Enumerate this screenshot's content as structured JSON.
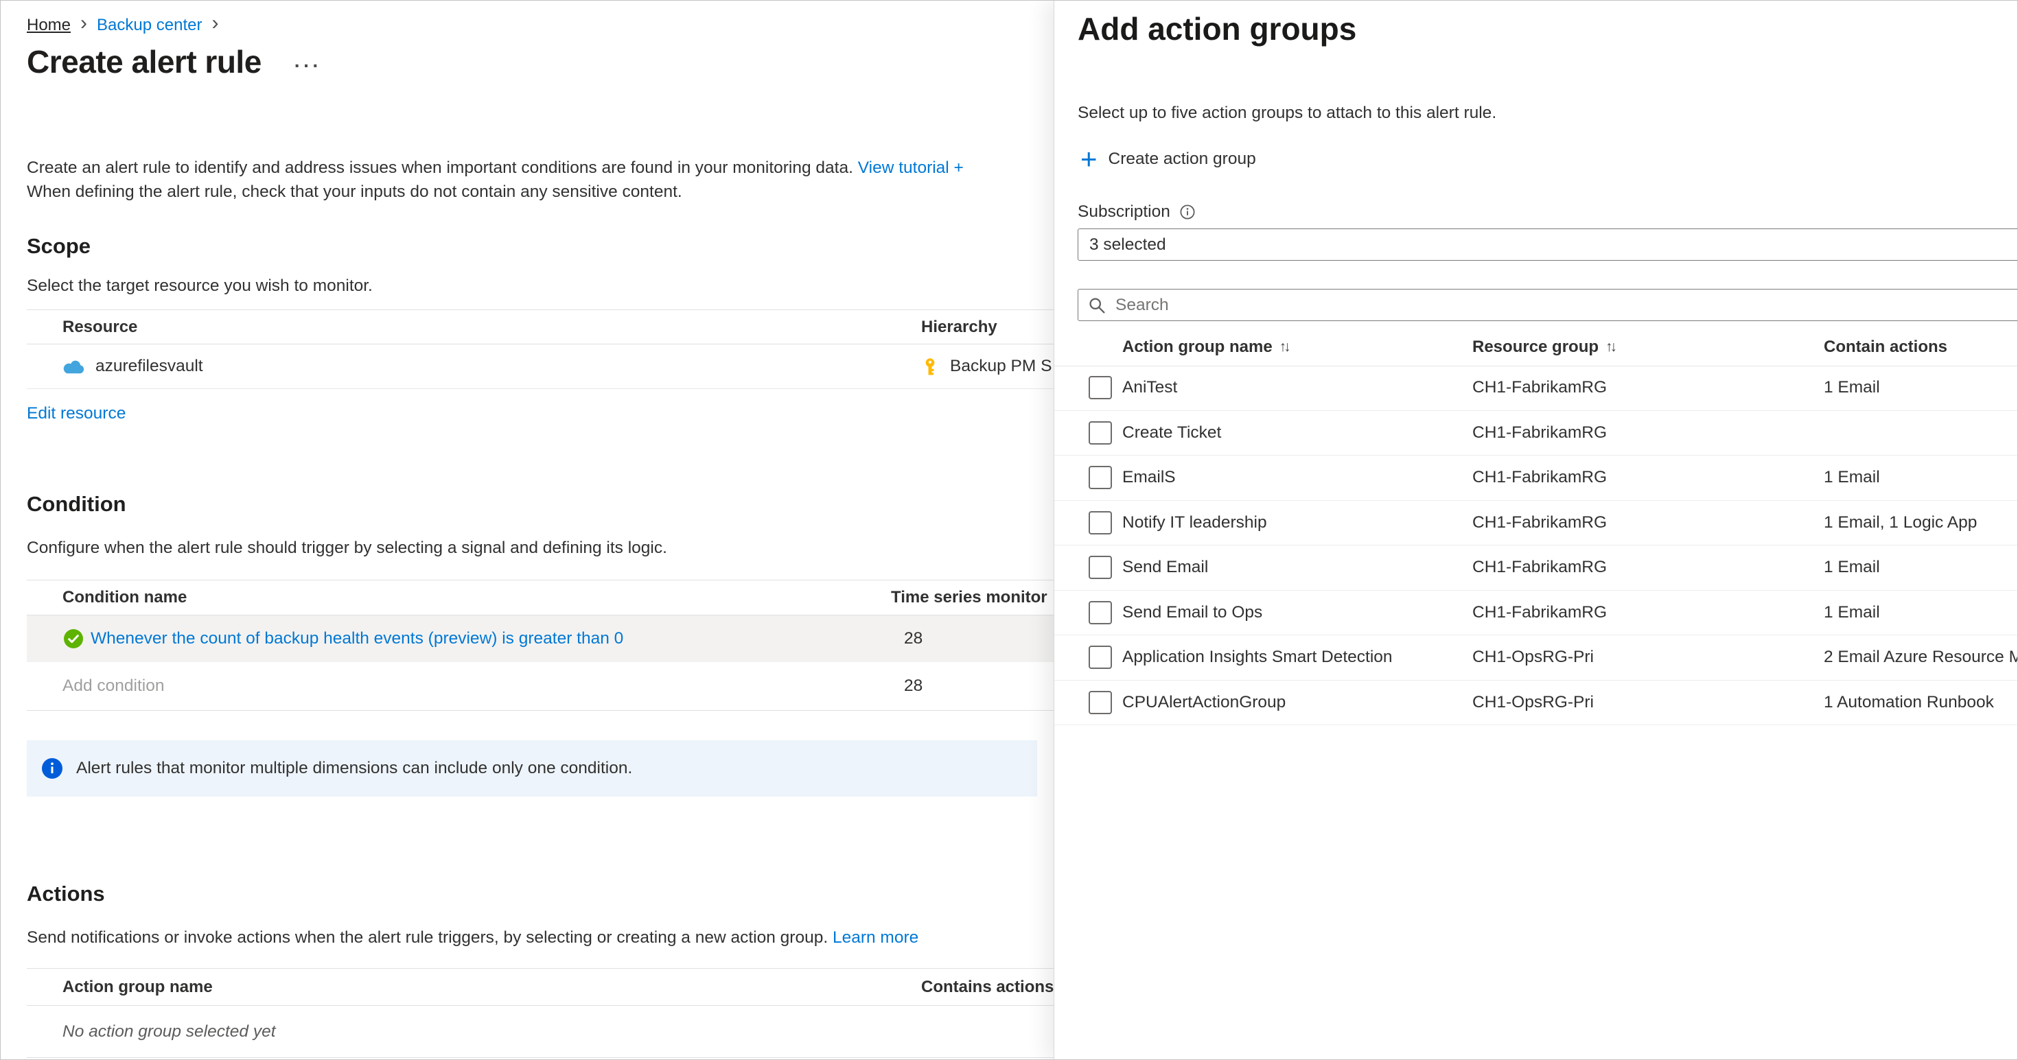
{
  "colors": {
    "accent_blue": "#0078d4",
    "success_green": "#5db300",
    "info_blue": "#015cda",
    "key_yellow": "#ffb900",
    "selected_row_bg": "#f3f2f1",
    "info_banner_bg": "#edf4fb"
  },
  "icons": {
    "breadcrumb_separator": "›",
    "ellipsis": "···",
    "plus": "+",
    "sort": "↑↓"
  },
  "page": {
    "breadcrumb": {
      "home": "Home",
      "backup_center": "Backup center"
    },
    "title": "Create alert rule",
    "intro_line1": "Create an alert rule to identify and address issues when important conditions are found in your monitoring data.",
    "intro_link": "View tutorial +",
    "intro_line2": "When defining the alert rule, check that your inputs do not contain any sensitive content.",
    "scope": {
      "heading": "Scope",
      "description": "Select the target resource you wish to monitor.",
      "columns": {
        "resource": "Resource",
        "hierarchy": "Hierarchy"
      },
      "row": {
        "resource_name": "azurefilesvault",
        "hierarchy": "Backup PM S"
      },
      "edit_link": "Edit resource"
    },
    "condition": {
      "heading": "Condition",
      "description": "Configure when the alert rule should trigger by selecting a signal and defining its logic.",
      "columns": {
        "name": "Condition name",
        "time_series": "Time series monitor"
      },
      "row": {
        "name": "Whenever the count of backup health events (preview) is greater than 0",
        "time_series": "28"
      },
      "add_condition": {
        "label": "Add condition",
        "time_series": "28"
      },
      "info": "Alert rules that monitor multiple dimensions can include only one condition."
    },
    "actions": {
      "heading": "Actions",
      "description": "Send notifications or invoke actions when the alert rule triggers, by selecting or creating a new action group.",
      "learn_more": "Learn more",
      "columns": {
        "name": "Action group name",
        "contains": "Contains actions"
      },
      "empty": "No action group selected yet"
    }
  },
  "panel": {
    "title": "Add action groups",
    "subtitle": "Select up to five action groups to attach to this alert rule.",
    "create_button": "Create action group",
    "subscription_label": "Subscription",
    "subscription_value": "3 selected",
    "search_placeholder": "Search",
    "columns": {
      "name": "Action group name",
      "resource_group": "Resource group",
      "contains": "Contain actions"
    },
    "rows": [
      {
        "name": "AniTest",
        "resource_group": "CH1-FabrikamRG",
        "contains": "1 Email"
      },
      {
        "name": "Create Ticket",
        "resource_group": "CH1-FabrikamRG",
        "contains": ""
      },
      {
        "name": "EmailS",
        "resource_group": "CH1-FabrikamRG",
        "contains": "1 Email"
      },
      {
        "name": "Notify IT leadership",
        "resource_group": "CH1-FabrikamRG",
        "contains": "1 Email, 1 Logic App"
      },
      {
        "name": "Send Email",
        "resource_group": "CH1-FabrikamRG",
        "contains": "1 Email"
      },
      {
        "name": "Send Email to Ops",
        "resource_group": "CH1-FabrikamRG",
        "contains": "1 Email"
      },
      {
        "name": "Application Insights Smart Detection",
        "resource_group": "CH1-OpsRG-Pri",
        "contains": "2 Email Azure Resource M"
      },
      {
        "name": "CPUAlertActionGroup",
        "resource_group": "CH1-OpsRG-Pri",
        "contains": "1 Automation Runbook"
      }
    ]
  }
}
